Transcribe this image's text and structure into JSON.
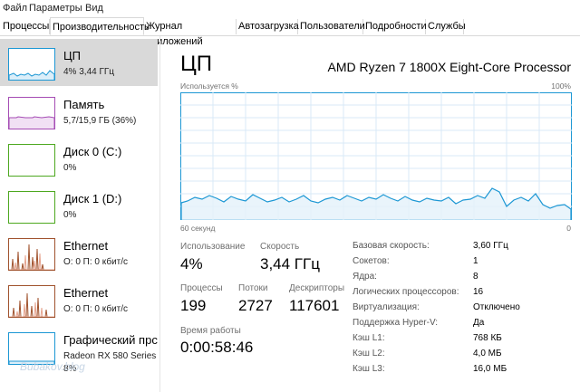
{
  "menu": [
    "Файл",
    "Параметры",
    "Вид"
  ],
  "tabs": [
    "Процессы",
    "Производительность",
    "Журнал приложений",
    "Автозагрузка",
    "Пользователи",
    "Подробности",
    "Службы"
  ],
  "colors": {
    "cpu": "#1c97d4",
    "memory": "#a54cb4",
    "disk": "#4da81f",
    "ethernet": "#a0522d",
    "gpu": "#1c97d4"
  },
  "sidebar": {
    "items": [
      {
        "title": "ЦП",
        "sub": "4%  3,44 ГГц",
        "sub2": ""
      },
      {
        "title": "Память",
        "sub": "5,7/15,9 ГБ (36%)",
        "sub2": ""
      },
      {
        "title": "Диск 0 (C:)",
        "sub": "0%",
        "sub2": ""
      },
      {
        "title": "Диск 1 (D:)",
        "sub": "0%",
        "sub2": ""
      },
      {
        "title": "Ethernet",
        "sub": "О: 0  П: 0 кбит/с",
        "sub2": ""
      },
      {
        "title": "Ethernet",
        "sub": "О: 0  П: 0 кбит/с",
        "sub2": ""
      },
      {
        "title": "Графический прс",
        "sub": "Radeon RX 580 Series",
        "sub2": "8%"
      }
    ]
  },
  "main": {
    "title": "ЦП",
    "processor": "AMD Ryzen 7 1800X Eight-Core Processor",
    "graph_label_top": "Используется %",
    "graph_label_max": "100%",
    "graph_label_time": "60 секунд",
    "graph_label_zero": "0",
    "stats": {
      "usage_label": "Использование",
      "usage_value": "4%",
      "speed_label": "Скорость",
      "speed_value": "3,44 ГГц",
      "processes_label": "Процессы",
      "processes_value": "199",
      "threads_label": "Потоки",
      "threads_value": "2727",
      "handles_label": "Дескрипторы",
      "handles_value": "117601",
      "uptime_label": "Время работы",
      "uptime_value": "0:00:58:46"
    },
    "details": [
      {
        "label": "Базовая скорость:",
        "value": "3,60 ГГц"
      },
      {
        "label": "Сокетов:",
        "value": "1"
      },
      {
        "label": "Ядра:",
        "value": "8"
      },
      {
        "label": "Логических процессоров:",
        "value": "16"
      },
      {
        "label": "Виртуализация:",
        "value": "Отключено"
      },
      {
        "label": "Поддержка Hyper-V:",
        "value": "Да"
      },
      {
        "label": "Кэш L1:",
        "value": "768 КБ"
      },
      {
        "label": "Кэш L2:",
        "value": "4,0 МБ"
      },
      {
        "label": "Кэш L3:",
        "value": "16,0 МБ"
      }
    ]
  },
  "watermark": "Bubakov.blog"
}
